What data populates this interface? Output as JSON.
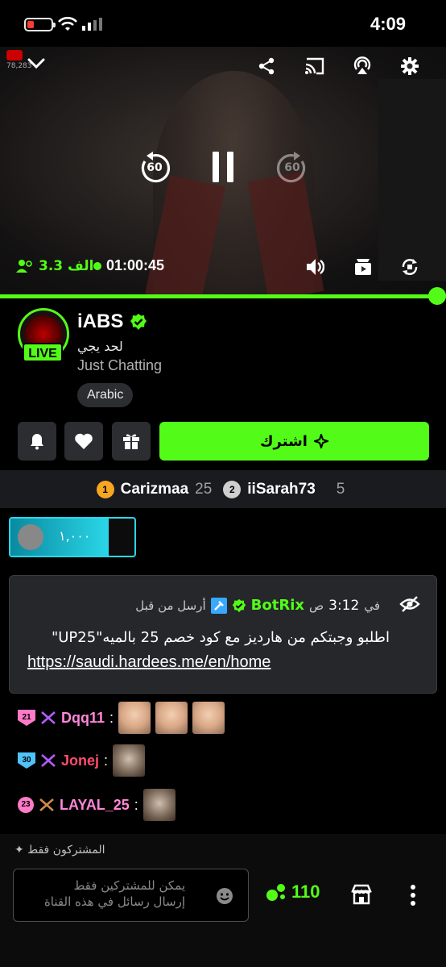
{
  "status_bar": {
    "time": "4:09"
  },
  "video": {
    "yt_count": "78,283",
    "viewer_count": "3.3 الف",
    "elapsed": "01:00:45",
    "rewind_seconds": "60",
    "forward_seconds": "60",
    "progress": 0.98
  },
  "channel": {
    "name": "iABS",
    "live_label": "LIVE",
    "stream_title": "لحد يجي",
    "category": "Just Chatting",
    "language": "Arabic",
    "subscribe_label": "اشترك"
  },
  "leaderboard": [
    {
      "rank": "1",
      "name": "Carizmaa",
      "count": "25",
      "color": "#f5a623"
    },
    {
      "rank": "2",
      "name": "iiSarah73",
      "count": "5",
      "color": "#cfcfcf"
    }
  ],
  "gift": {
    "amount": "١,٠٠٠"
  },
  "pinned": {
    "user": "BotRix",
    "time": "3:12",
    "time_prefix": "في",
    "time_suffix": "ص",
    "sent_by": "أرسل من قبل",
    "text": "اطلبو وجبتكم من هارديز مع كود خصم 25 بالميه\"UP25\"",
    "link": "https://saudi.hardees.me/en/home"
  },
  "chat": [
    {
      "badge": "21",
      "badge_color": "#ff7ac8",
      "user": "Dqq11",
      "color": "#ff86d9",
      "emotes": 3
    },
    {
      "badge": "30",
      "badge_color": "#4fc3f7",
      "user": "Jonej",
      "color": "#ff4d6d",
      "emotes": 1
    },
    {
      "badge": "23",
      "badge_color": "#ff7ac8",
      "user": "LAYAL_25",
      "color": "#ff86d9",
      "emotes": 1
    }
  ],
  "input": {
    "subscribers_only": "المشتركون فقط",
    "placeholder_line1": "يمكن للمشتركين فقط",
    "placeholder_line2": "إرسال رسائل في هذه القناة",
    "points": "110"
  },
  "colors": {
    "accent": "#53fc18",
    "card": "#25272b",
    "button": "#2b2d31"
  }
}
